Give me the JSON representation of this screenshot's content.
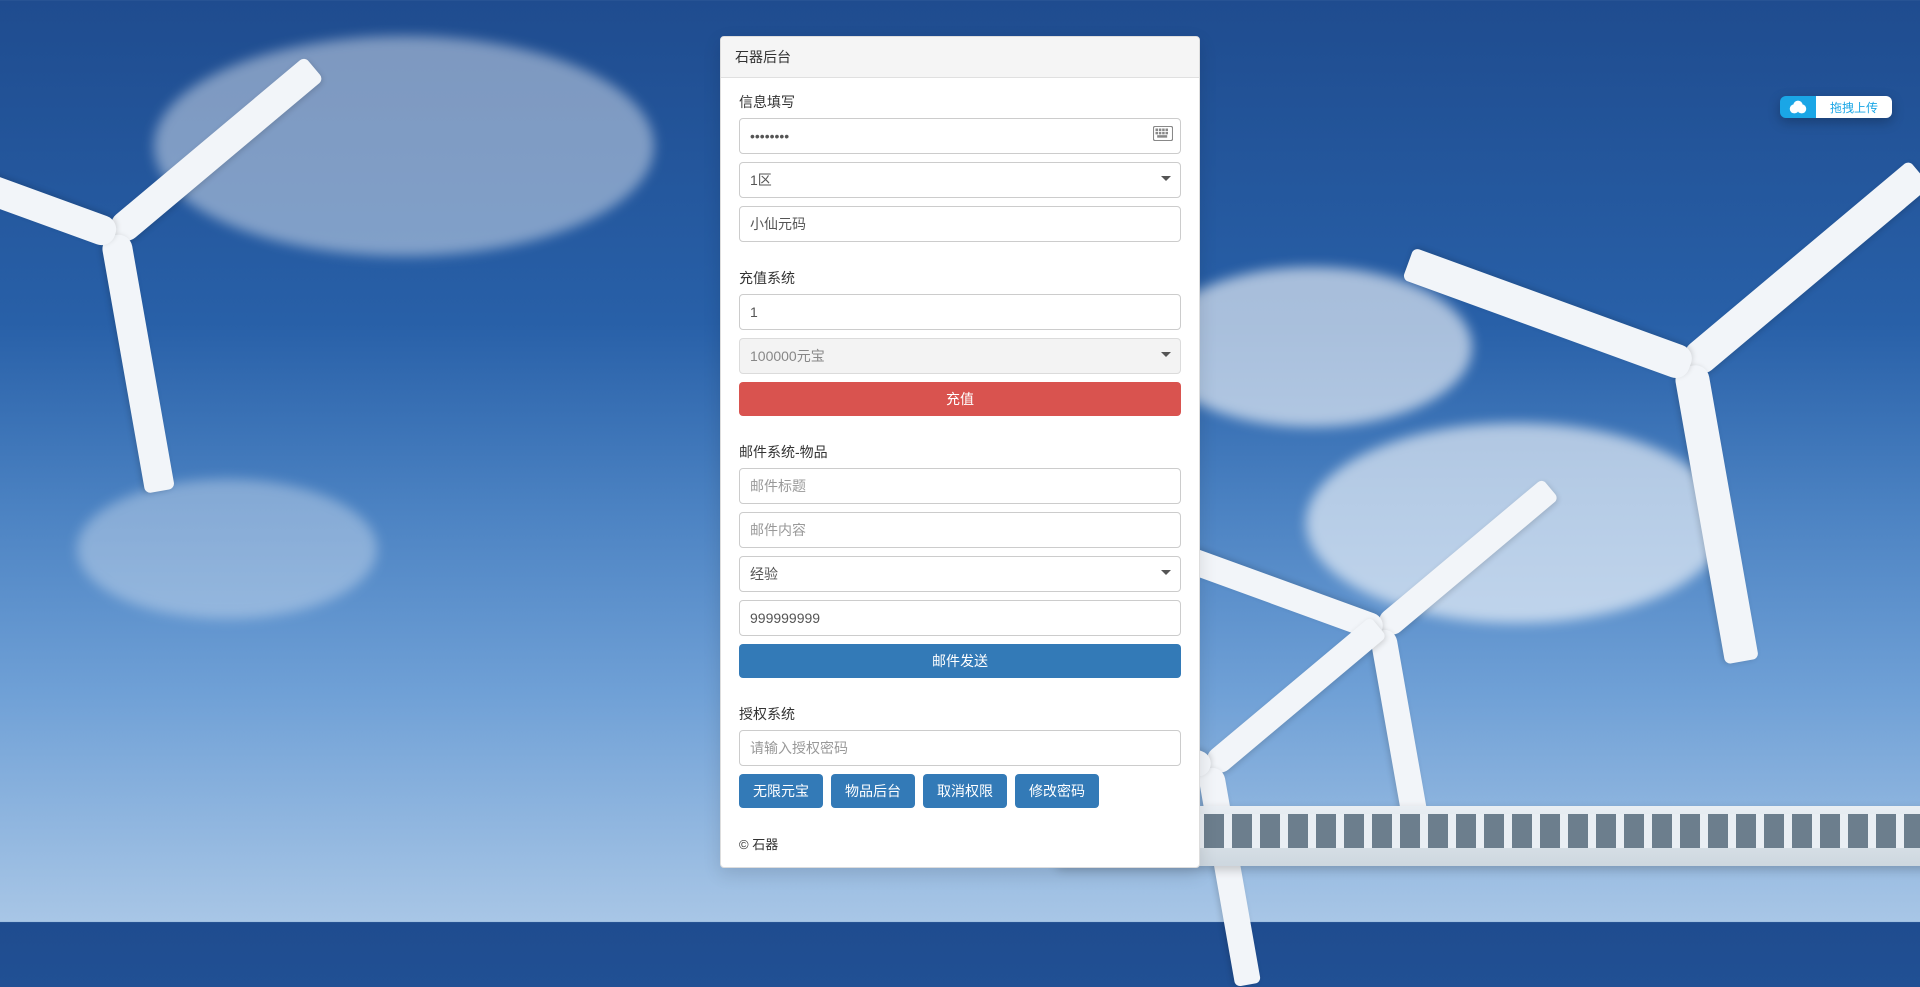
{
  "panel": {
    "title": "石器后台",
    "footer": "© 石器"
  },
  "info": {
    "section_label": "信息填写",
    "password_value": "••••••••",
    "zone_value": "1区",
    "charname_value": "小仙元码"
  },
  "recharge": {
    "section_label": "充值系统",
    "amount_value": "1",
    "package_value": "100000元宝",
    "submit_label": "充值"
  },
  "mail": {
    "section_label": "邮件系统-物品",
    "title_placeholder": "邮件标题",
    "content_placeholder": "邮件内容",
    "type_value": "经验",
    "qty_value": "999999999",
    "submit_label": "邮件发送"
  },
  "auth": {
    "section_label": "授权系统",
    "password_placeholder": "请输入授权密码",
    "btn_unlimited": "无限元宝",
    "btn_item_backend": "物品后台",
    "btn_revoke": "取消权限",
    "btn_change_pwd": "修改密码"
  },
  "upload_widget": {
    "label": "拖拽上传"
  }
}
